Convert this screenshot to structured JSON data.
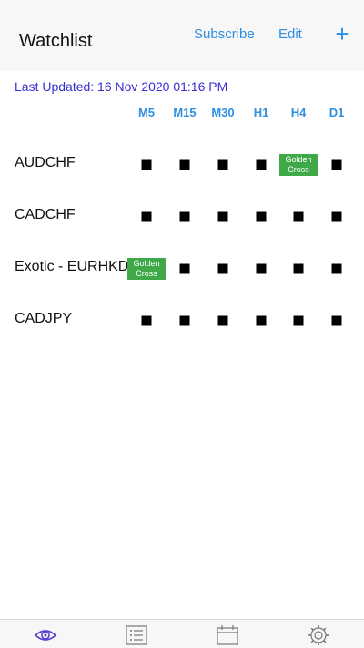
{
  "header": {
    "title": "Watchlist",
    "subscribe_label": "Subscribe",
    "edit_label": "Edit",
    "add_label": "+"
  },
  "last_updated": "Last Updated: 16 Nov 2020 01:16 PM",
  "timeframes": [
    "M5",
    "M15",
    "M30",
    "H1",
    "H4",
    "D1"
  ],
  "rows": [
    {
      "name": "AUDCHF",
      "signals": [
        "",
        "",
        "",
        "",
        "Golden Cross",
        ""
      ]
    },
    {
      "name": "CADCHF",
      "signals": [
        "",
        "",
        "",
        "",
        "",
        ""
      ]
    },
    {
      "name": "Exotic - EURHKD",
      "signals": [
        "Golden Cross",
        "",
        "",
        "",
        "",
        ""
      ]
    },
    {
      "name": "CADJPY",
      "signals": [
        "",
        "",
        "",
        "",
        "",
        ""
      ]
    }
  ],
  "tabs": [
    {
      "icon": "eye-icon",
      "active": true
    },
    {
      "icon": "list-icon",
      "active": false
    },
    {
      "icon": "calendar-icon",
      "active": false
    },
    {
      "icon": "gear-icon",
      "active": false
    }
  ],
  "colors": {
    "accent": "#2f8fe0",
    "updated_text": "#3a2fd0",
    "golden_cross": "#3fa94a",
    "active_tab": "#5b3fd0",
    "inactive_tab": "#777777"
  }
}
